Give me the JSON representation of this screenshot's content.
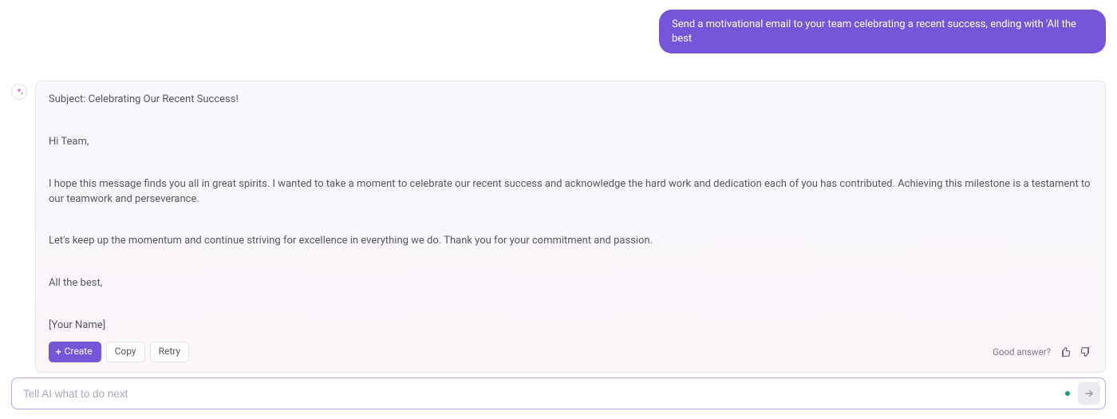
{
  "user_message": "Send a motivational email to your team celebrating a recent success, ending with 'All the best",
  "assistant": {
    "email": {
      "subject_line": "Subject: Celebrating Our Recent Success!",
      "greeting": "Hi Team,",
      "para1": "I hope this message finds you all in great spirits. I wanted to take a moment to celebrate our recent success and acknowledge the hard work and dedication each of you has contributed. Achieving this milestone is a testament to our teamwork and perseverance.",
      "para2": "Let's keep up the momentum and continue striving for excellence in everything we do. Thank you for your commitment and passion.",
      "signoff": "All the best,",
      "signature": "[Your Name]"
    },
    "actions": {
      "create": "Create",
      "copy": "Copy",
      "retry": "Retry"
    },
    "feedback_label": "Good answer?"
  },
  "composer": {
    "placeholder": "Tell AI what to do next"
  },
  "colors": {
    "accent": "#7556d9"
  }
}
